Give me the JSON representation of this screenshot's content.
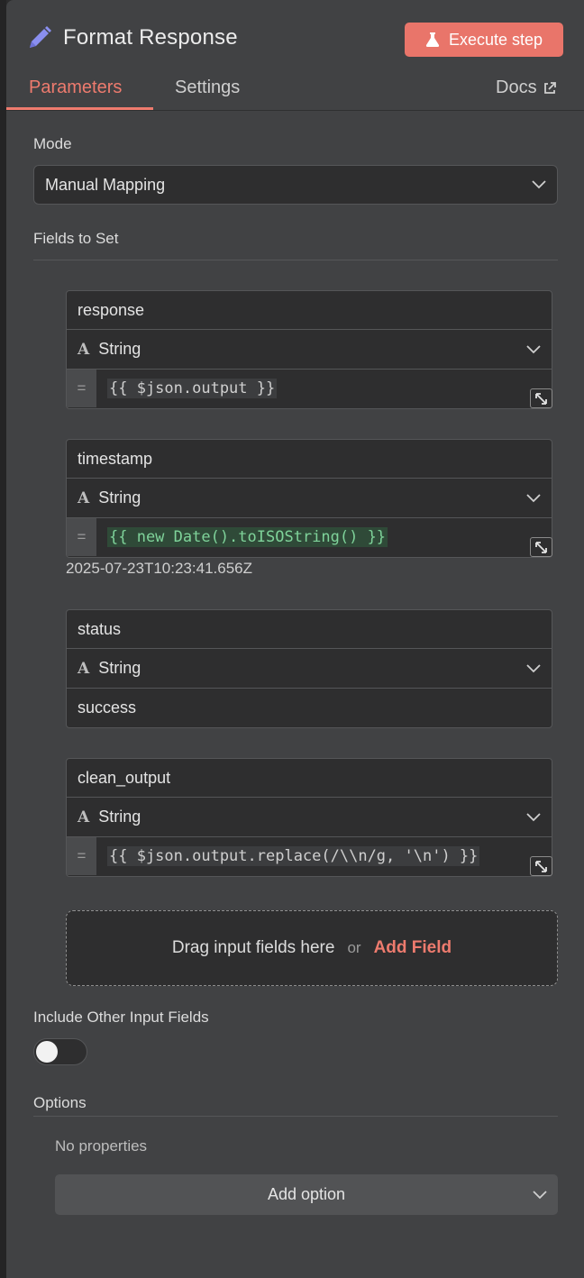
{
  "header": {
    "title": "Format Response",
    "execute_label": "Execute step"
  },
  "tabs": {
    "parameters": "Parameters",
    "settings": "Settings",
    "docs": "Docs"
  },
  "mode": {
    "label": "Mode",
    "value": "Manual Mapping"
  },
  "fields_section": {
    "label": "Fields to Set"
  },
  "fields": [
    {
      "name": "response",
      "type": "String",
      "value": "{{ $json.output }}"
    },
    {
      "name": "timestamp",
      "type": "String",
      "value": "{{ new Date().toISOString() }}",
      "preview": "2025-07-23T10:23:41.656Z"
    },
    {
      "name": "status",
      "type": "String",
      "value": "success"
    },
    {
      "name": "clean_output",
      "type": "String",
      "value": "{{ $json.output.replace(/\\\\n/g, '\\n') }}"
    }
  ],
  "dropzone": {
    "text": "Drag input fields here",
    "or": "or",
    "add_field": "Add Field"
  },
  "include_other": {
    "label": "Include Other Input Fields",
    "enabled": false
  },
  "options": {
    "label": "Options",
    "empty_text": "No properties",
    "add_label": "Add option"
  },
  "colors": {
    "accent": "#ee7b6e",
    "execute_bg": "#e9756a",
    "panel_bg": "#414244",
    "input_bg": "#2e2e2f",
    "expression_green": "#7fd39a"
  }
}
